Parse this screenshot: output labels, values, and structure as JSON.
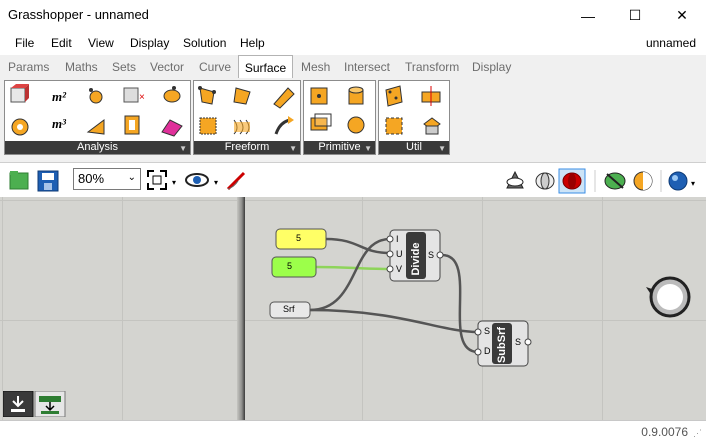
{
  "window": {
    "title": "Grasshopper - unnamed",
    "minimize_glyph": "—",
    "maximize_glyph": "☐",
    "close_glyph": "✕"
  },
  "menu": {
    "items": [
      "File",
      "Edit",
      "View",
      "Display",
      "Solution",
      "Help"
    ],
    "document_name": "unnamed"
  },
  "tabs": {
    "items": [
      "Params",
      "Maths",
      "Sets",
      "Vector",
      "Curve",
      "Surface",
      "Mesh",
      "Intersect",
      "Transform",
      "Display"
    ],
    "active": "Surface"
  },
  "ribbon": {
    "panels": [
      {
        "label": "Analysis"
      },
      {
        "label": "Freeform"
      },
      {
        "label": "Primitive"
      },
      {
        "label": "Util"
      }
    ],
    "analysis_area_label": "m²",
    "analysis_volume_label": "m³"
  },
  "toolbar": {
    "zoom_value": "80%"
  },
  "canvas": {
    "nodes": {
      "slider_a": {
        "value": "5",
        "color": "#ffff66"
      },
      "slider_b": {
        "value": "5",
        "color": "#9cff4a"
      },
      "srf_param": {
        "label": "Srf"
      },
      "divide": {
        "title": "Divide",
        "inputs": [
          "I",
          "U",
          "V"
        ],
        "outputs": [
          "S"
        ]
      },
      "subsrf": {
        "title": "SubSrf",
        "inputs": [
          "S",
          "D"
        ],
        "outputs": [
          "S"
        ]
      }
    }
  },
  "status": {
    "version": "0.9.0076"
  }
}
